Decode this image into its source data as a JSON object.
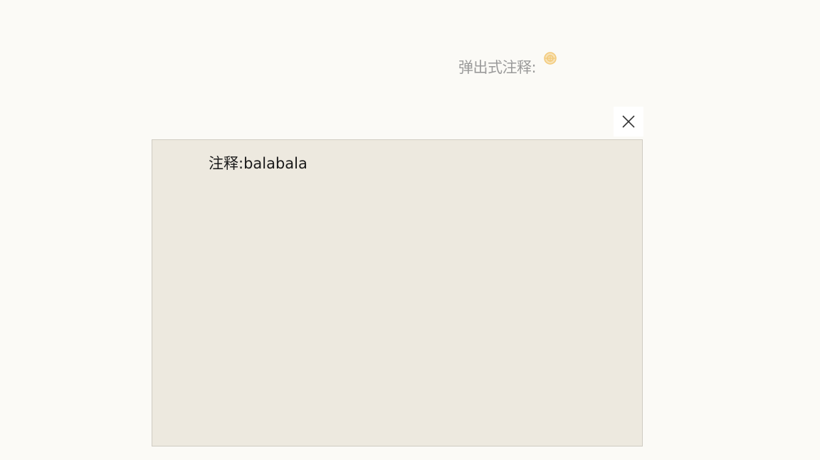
{
  "popup": {
    "label": "弹出式注释:",
    "icon": "note-marker-icon",
    "accent_color": "#f3c979"
  },
  "dialog": {
    "close_icon": "close-icon",
    "content": "注释:balabala"
  }
}
